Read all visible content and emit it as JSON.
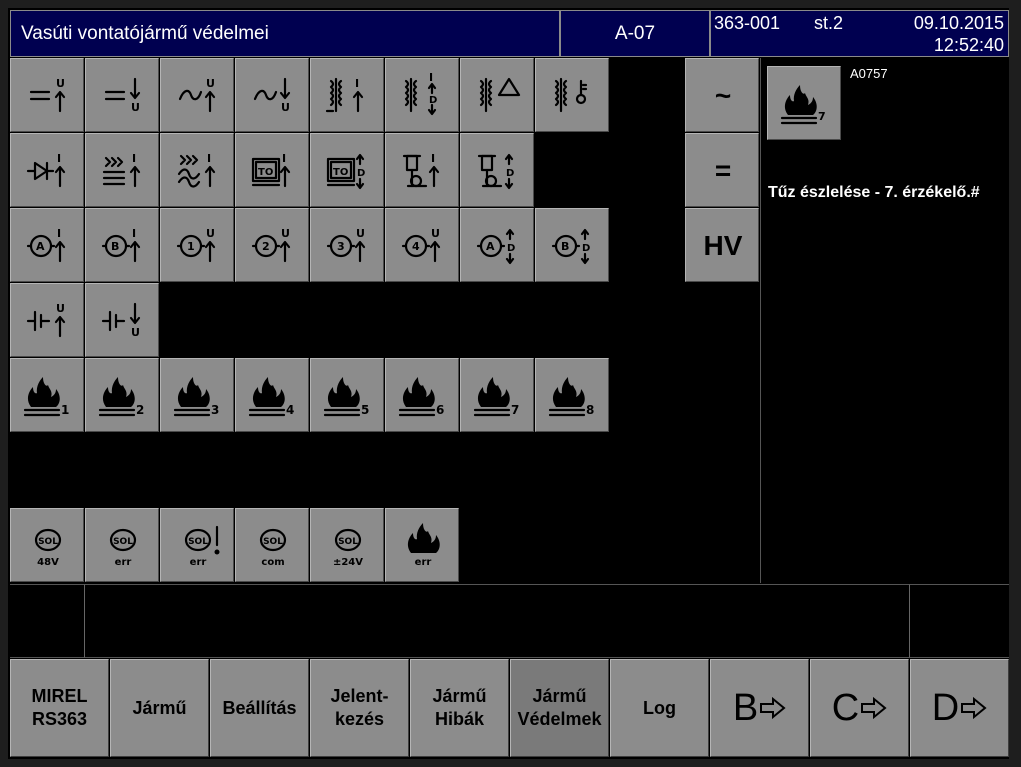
{
  "header": {
    "title": "Vasúti vontatójármű védelmei",
    "screen_code": "A-07",
    "vehicle_id": "363-001",
    "station": "st.2",
    "date": "09.10.2015",
    "time": "12:52:40"
  },
  "fire_sensors": [
    "1",
    "2",
    "3",
    "4",
    "5",
    "6",
    "7",
    "8"
  ],
  "sol_tiles": [
    {
      "top": "SOL",
      "bottom": "48V"
    },
    {
      "top": "SOL",
      "bottom": "err"
    },
    {
      "top": "SOL",
      "bottom": "err"
    },
    {
      "top": "SOL",
      "bottom": "com"
    },
    {
      "top": "SOL",
      "bottom": "±24V"
    },
    {
      "top": "",
      "bottom": "err"
    }
  ],
  "modes": {
    "ac": "~",
    "dc": "=",
    "hv": "HV"
  },
  "alarm": {
    "code": "A0757",
    "sensor_index": "7",
    "text": "Tűz észlelése - 7. érzékelő.#"
  },
  "nav": {
    "mirel_line1": "MIREL",
    "mirel_line2": "RS363",
    "jarmu": "Jármű",
    "beallitas": "Beállítás",
    "jelent_line1": "Jelent-",
    "jelent_line2": "kezés",
    "hibak_line1": "Jármű",
    "hibak_line2": "Hibák",
    "vedelmek_line1": "Jármű",
    "vedelmek_line2": "Védelmek",
    "log": "Log",
    "b": "B",
    "c": "C",
    "d": "D"
  },
  "colors": {
    "header_bg": "#000050",
    "tile_bg": "#8c8c8c",
    "screen_bg": "#000000"
  }
}
